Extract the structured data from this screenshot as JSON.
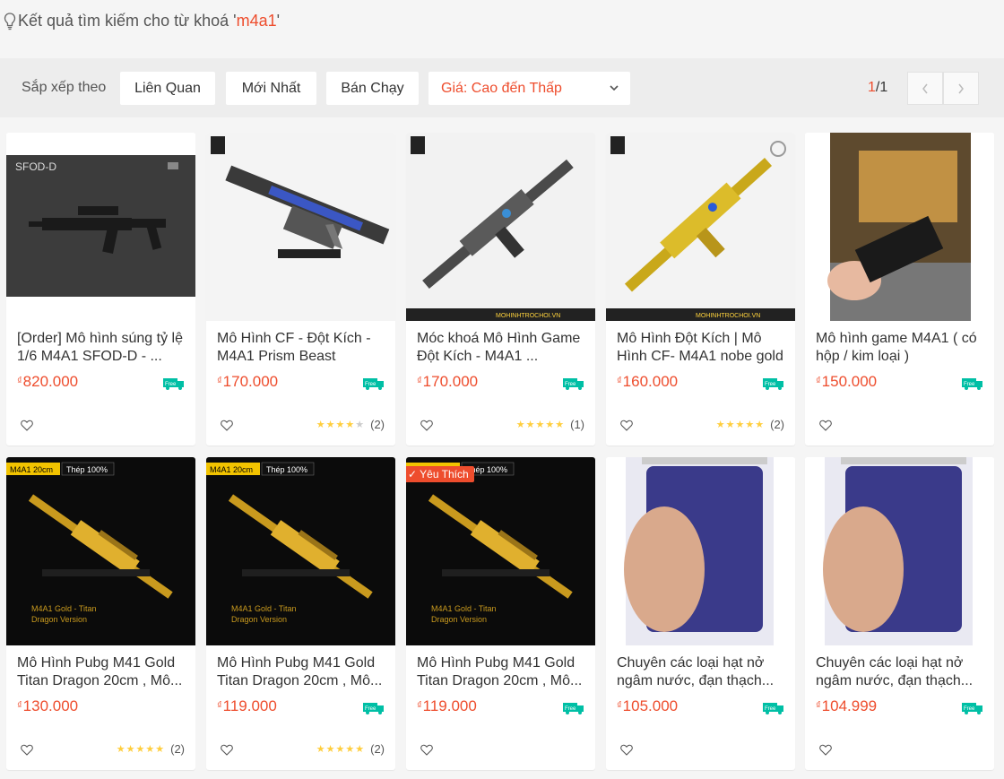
{
  "search": {
    "prefix": "Kết quả tìm kiếm cho từ khoá '",
    "keyword": "m4a1",
    "suffix": "'"
  },
  "sort": {
    "label": "Sắp xếp theo",
    "options": [
      "Liên Quan",
      "Mới Nhất",
      "Bán Chạy"
    ],
    "price_select": "Giá: Cao đến Thấp"
  },
  "pager": {
    "current": "1",
    "total": "/1"
  },
  "currency": "₫",
  "free_label": "Free",
  "products": [
    {
      "title": "[Order] Mô hình súng tỷ lệ 1/6 M4A1 SFOD-D - ...",
      "price": "820.000",
      "stars": 0,
      "count": ""
    },
    {
      "title": "Mô Hình CF - Đột Kích - M4A1 Prism Beast",
      "price": "170.000",
      "stars": 4,
      "count": "(2)"
    },
    {
      "title": "Móc khoá Mô Hình Game Đột Kích - M4A1 ...",
      "price": "170.000",
      "stars": 5,
      "count": "(1)"
    },
    {
      "title": "Mô Hình Đột Kích | Mô Hình CF- M4A1 nobe gold",
      "price": "160.000",
      "stars": 5,
      "count": "(2)"
    },
    {
      "title": "Mô hình game M4A1 ( có hộp / kim loại )",
      "price": "150.000",
      "stars": 0,
      "count": ""
    },
    {
      "title": "Mô Hình Pubg M41 Gold Titan Dragon 20cm , Mô...",
      "price": "130.000",
      "stars": 5,
      "count": "(2)"
    },
    {
      "title": "Mô Hình Pubg M41 Gold Titan Dragon 20cm , Mô...",
      "price": "119.000",
      "stars": 5,
      "count": "(2)"
    },
    {
      "title": "Mô Hình Pubg M41 Gold Titan Dragon 20cm , Mô...",
      "price": "119.000",
      "stars": 0,
      "count": "",
      "badge": "Yêu Thích"
    },
    {
      "title": "Chuyên các loại hạt nở ngâm nước, đạn thạch...",
      "price": "105.000",
      "stars": 0,
      "count": ""
    },
    {
      "title": "Chuyên các loại hạt nở ngâm nước, đạn thạch...",
      "price": "104.999",
      "stars": 0,
      "count": ""
    }
  ],
  "image_labels": {
    "sfod": "SFOD-D",
    "gold_tag": "M4A1 20cm",
    "steel_tag": "Thép 100%",
    "gold_caption_1": "M4A1 Gold - Titan",
    "gold_caption_2": "Dragon Version",
    "shop_banner": "MOHINHTROCHOI.VN"
  },
  "colors": {
    "accent": "#ee4d2d",
    "free_ship": "#00bfa5",
    "star": "#ffce3d"
  }
}
